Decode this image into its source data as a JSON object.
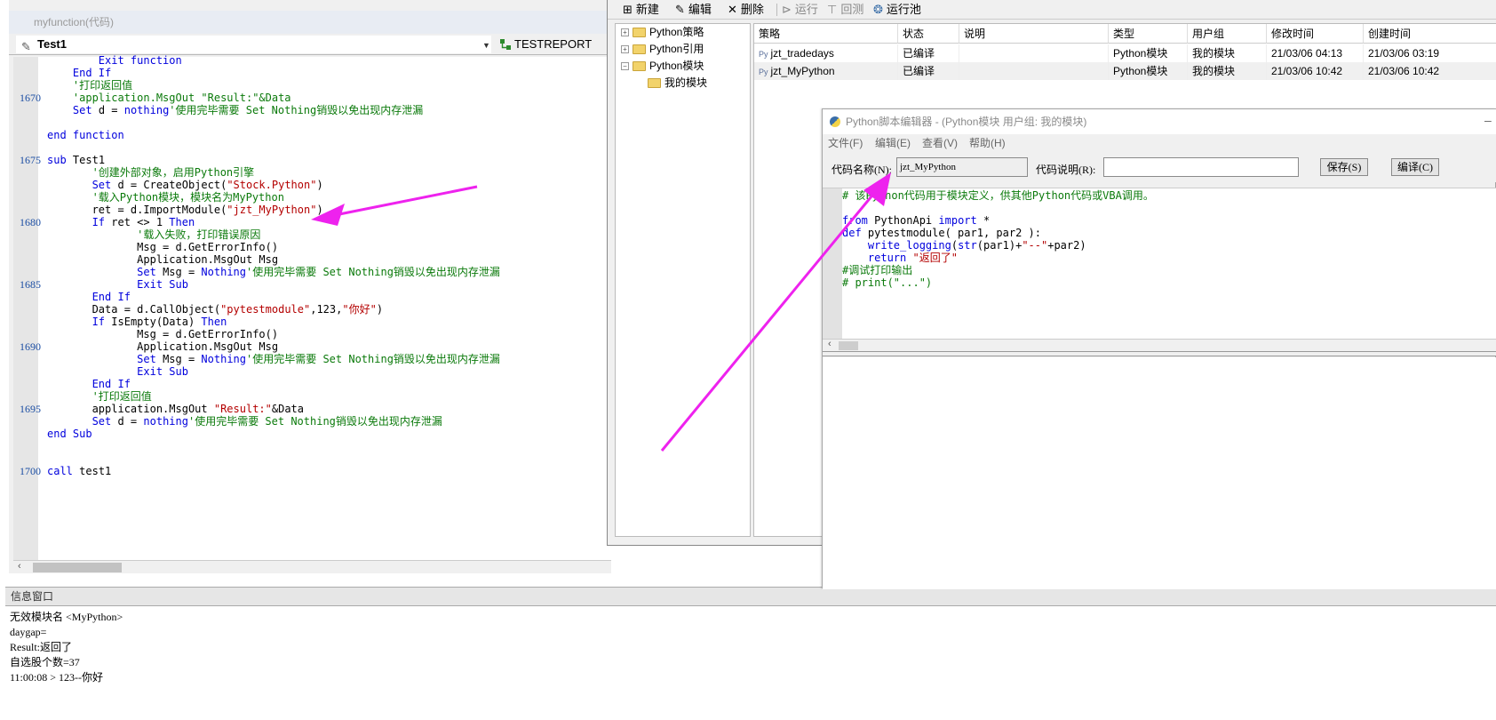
{
  "vba_window": {
    "title": "myfunction(代码)",
    "procedure": "Test1",
    "report_button": "TESTREPORT",
    "line_numbers": [
      "1670",
      "1675",
      "1680",
      "1685",
      "1690",
      "1695",
      "1700"
    ]
  },
  "info_window": {
    "title": "信息窗口",
    "lines": [
      "无效模块名 <MyPython>",
      "daygap=",
      "Result:返回了",
      "自选股个数=37",
      "11:00:08 > 123--你好"
    ]
  },
  "manager": {
    "toolbar": {
      "new": "新建",
      "edit": "编辑",
      "delete": "删除",
      "run": "运行",
      "backtest": "回测",
      "run_pool": "运行池"
    },
    "tree": [
      "Python策略",
      "Python引用",
      "Python模块",
      "我的模块"
    ],
    "columns": [
      "策略",
      "状态",
      "说明",
      "类型",
      "用户组",
      "修改时间",
      "创建时间"
    ],
    "rows": [
      {
        "name": "jzt_tradedays",
        "status": "已编译",
        "desc": "",
        "type": "Python模块",
        "group": "我的模块",
        "modified": "21/03/06 04:13",
        "created": "21/03/06 03:19"
      },
      {
        "name": "jzt_MyPython",
        "status": "已编译",
        "desc": "",
        "type": "Python模块",
        "group": "我的模块",
        "modified": "21/03/06 10:42",
        "created": "21/03/06 10:42"
      }
    ]
  },
  "python_editor": {
    "title": "Python脚本编辑器 - (Python模块 用户组: 我的模块)",
    "menu": [
      "文件(F)",
      "编辑(E)",
      "查看(V)",
      "帮助(H)"
    ],
    "code_name_label": "代码名称(N):",
    "code_name_value": "jzt_MyPython",
    "code_desc_label": "代码说明(R):",
    "code_desc_value": "",
    "save_button": "保存(S)",
    "compile_button": "编译(C)"
  },
  "colors": {
    "keyword": "#0000dd",
    "comment": "#0b7a0b",
    "string": "#b40000",
    "arrow": "#ee22ee"
  }
}
